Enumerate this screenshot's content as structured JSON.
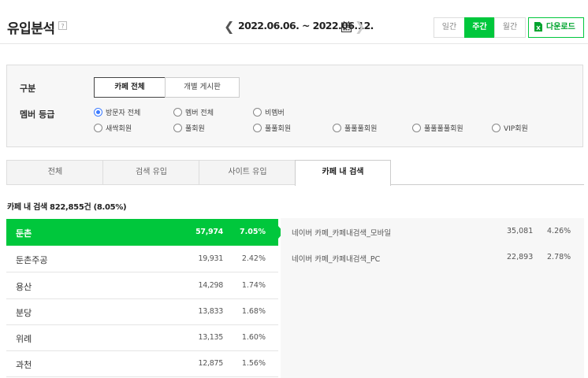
{
  "header": {
    "title": "유입분석",
    "help_label": "?",
    "date_range": "2022.06.06. ~ 2022.06.12.",
    "periods": [
      "일간",
      "주간",
      "월간"
    ],
    "selected_period": "주간",
    "download_label": "다운로드"
  },
  "filters": {
    "category_label": "구분",
    "category_options": [
      "카페 전체",
      "개별 게시판"
    ],
    "selected_category": "카페 전체",
    "member_label": "멤버 등급",
    "member_options": [
      "방문자 전체",
      "멤버 전체",
      "비멤버",
      "새싹회원",
      "풀회원",
      "풀풀회원",
      "풀풀풀회원",
      "풀풀풀풀회원",
      "VIP회원"
    ],
    "selected_member": "방문자 전체"
  },
  "tabs": [
    "전체",
    "검색 유입",
    "사이트 유입",
    "카페 내 검색"
  ],
  "active_tab": "카페 내 검색",
  "summary": "카페 내 검색 822,855건 (8.05%)",
  "keywords": [
    {
      "name": "둔촌",
      "count": "57,974",
      "pct": "7.05%"
    },
    {
      "name": "둔촌주공",
      "count": "19,931",
      "pct": "2.42%"
    },
    {
      "name": "용산",
      "count": "14,298",
      "pct": "1.74%"
    },
    {
      "name": "분당",
      "count": "13,833",
      "pct": "1.68%"
    },
    {
      "name": "위례",
      "count": "13,135",
      "pct": "1.60%"
    },
    {
      "name": "과천",
      "count": "12,875",
      "pct": "1.56%"
    }
  ],
  "selected_keyword": "둔촌",
  "details": [
    {
      "source": "네이버 카페_카페내검색_모바일",
      "count": "35,081",
      "pct": "4.26%"
    },
    {
      "source": "네이버 카페_카페내검색_PC",
      "count": "22,893",
      "pct": "2.78%"
    }
  ],
  "colors": {
    "accent": "#00c73c",
    "radio_selected": "#3d7bff"
  }
}
